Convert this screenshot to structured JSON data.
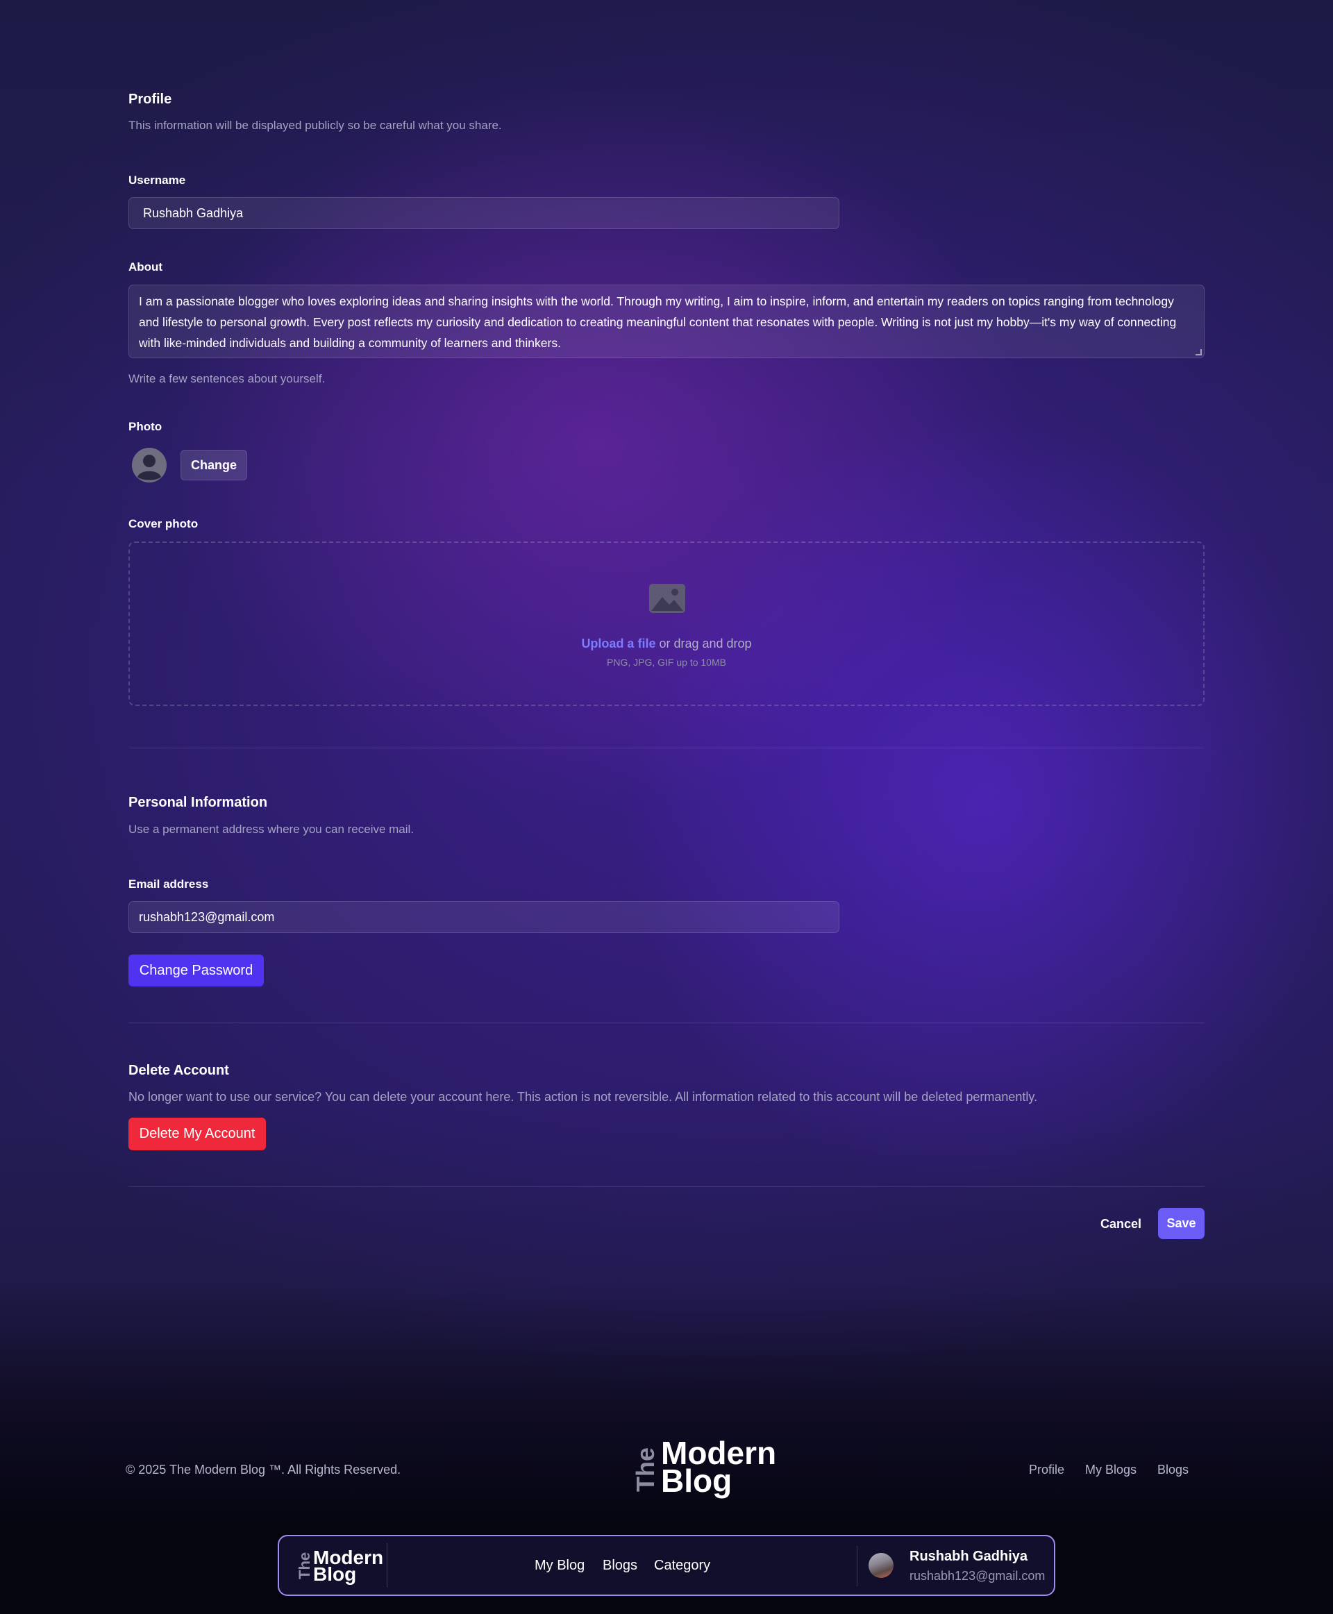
{
  "profile": {
    "title": "Profile",
    "description": "This information will be displayed publicly so be careful what you share.",
    "username_label": "Username",
    "username_value": "Rushabh Gadhiya",
    "about_label": "About",
    "about_value": "I am a passionate blogger who loves exploring ideas and sharing insights with the world. Through my writing, I aim to inspire, inform, and entertain my readers on topics ranging from technology and lifestyle to personal growth. Every post reflects my curiosity and dedication to creating meaningful content that resonates with people. Writing is not just my hobby—it's my way of connecting with like-minded individuals and building a community of learners and thinkers.",
    "about_hint": "Write a few sentences about yourself.",
    "photo_label": "Photo",
    "photo_change_button": "Change",
    "cover_label": "Cover photo",
    "cover_upload_link": "Upload a file",
    "cover_upload_text": " or drag and drop",
    "cover_upload_hint": "PNG, JPG, GIF up to 10MB"
  },
  "personal": {
    "title": "Personal Information",
    "description": "Use a permanent address where you can receive mail.",
    "email_label": "Email address",
    "email_value": "rushabh123@gmail.com",
    "change_password_button": "Change Password"
  },
  "delete": {
    "title": "Delete Account",
    "description": "No longer want to use our service? You can delete your account here. This action is not reversible. All information related to this account will be deleted permanently.",
    "button": "Delete My Account"
  },
  "actions": {
    "cancel": "Cancel",
    "save": "Save"
  },
  "footer": {
    "copyright": "© 2025 The Modern Blog ™. All Rights Reserved.",
    "logo_the": "The",
    "logo_line1": "Modern",
    "logo_line2": "Blog",
    "links": [
      "Profile",
      "My Blogs",
      "Blogs"
    ]
  },
  "navbar": {
    "logo_the": "The",
    "logo_line1": "Modern",
    "logo_line2": "Blog",
    "links": [
      "My Blog",
      "Blogs",
      "Category"
    ],
    "user_name": "Rushabh Gadhiya",
    "user_email": "rushabh123@gmail.com"
  },
  "colors": {
    "accent": "#4f33f0",
    "save": "#6a5cf5",
    "danger": "#f0283c",
    "link": "#7b7cff",
    "nav_border": "#a08cf0"
  }
}
